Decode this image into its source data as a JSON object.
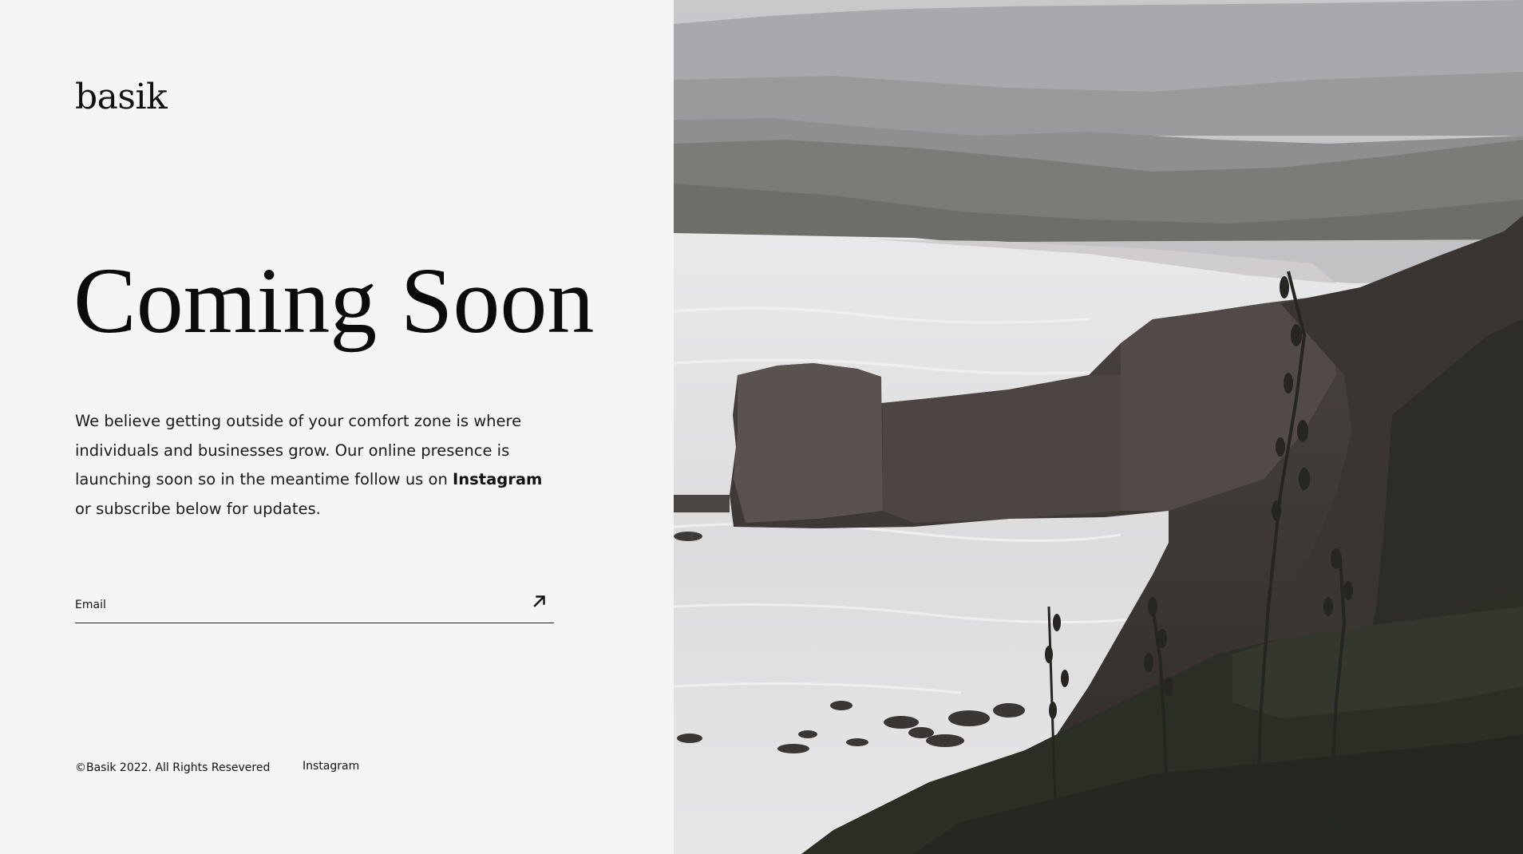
{
  "brand": {
    "logo_text": "basik"
  },
  "hero": {
    "title": "Coming Soon",
    "intro_before": "We believe getting outside of your comfort zone is where individuals and businesses grow. Our online presence is launching soon so in the meantime follow us on ",
    "intro_link": "Instagram",
    "intro_after": " or subscribe below for updates."
  },
  "subscribe": {
    "email_placeholder": "Email",
    "submit_icon": "arrow-up-right-icon"
  },
  "footer": {
    "copyright": "©Basik 2022. All Rights Resevered",
    "instagram_link": "Instagram"
  },
  "photo": {
    "subject": "coastal-cliffs-landscape"
  },
  "colors": {
    "background": "#f5f5f5",
    "text": "#111111"
  }
}
